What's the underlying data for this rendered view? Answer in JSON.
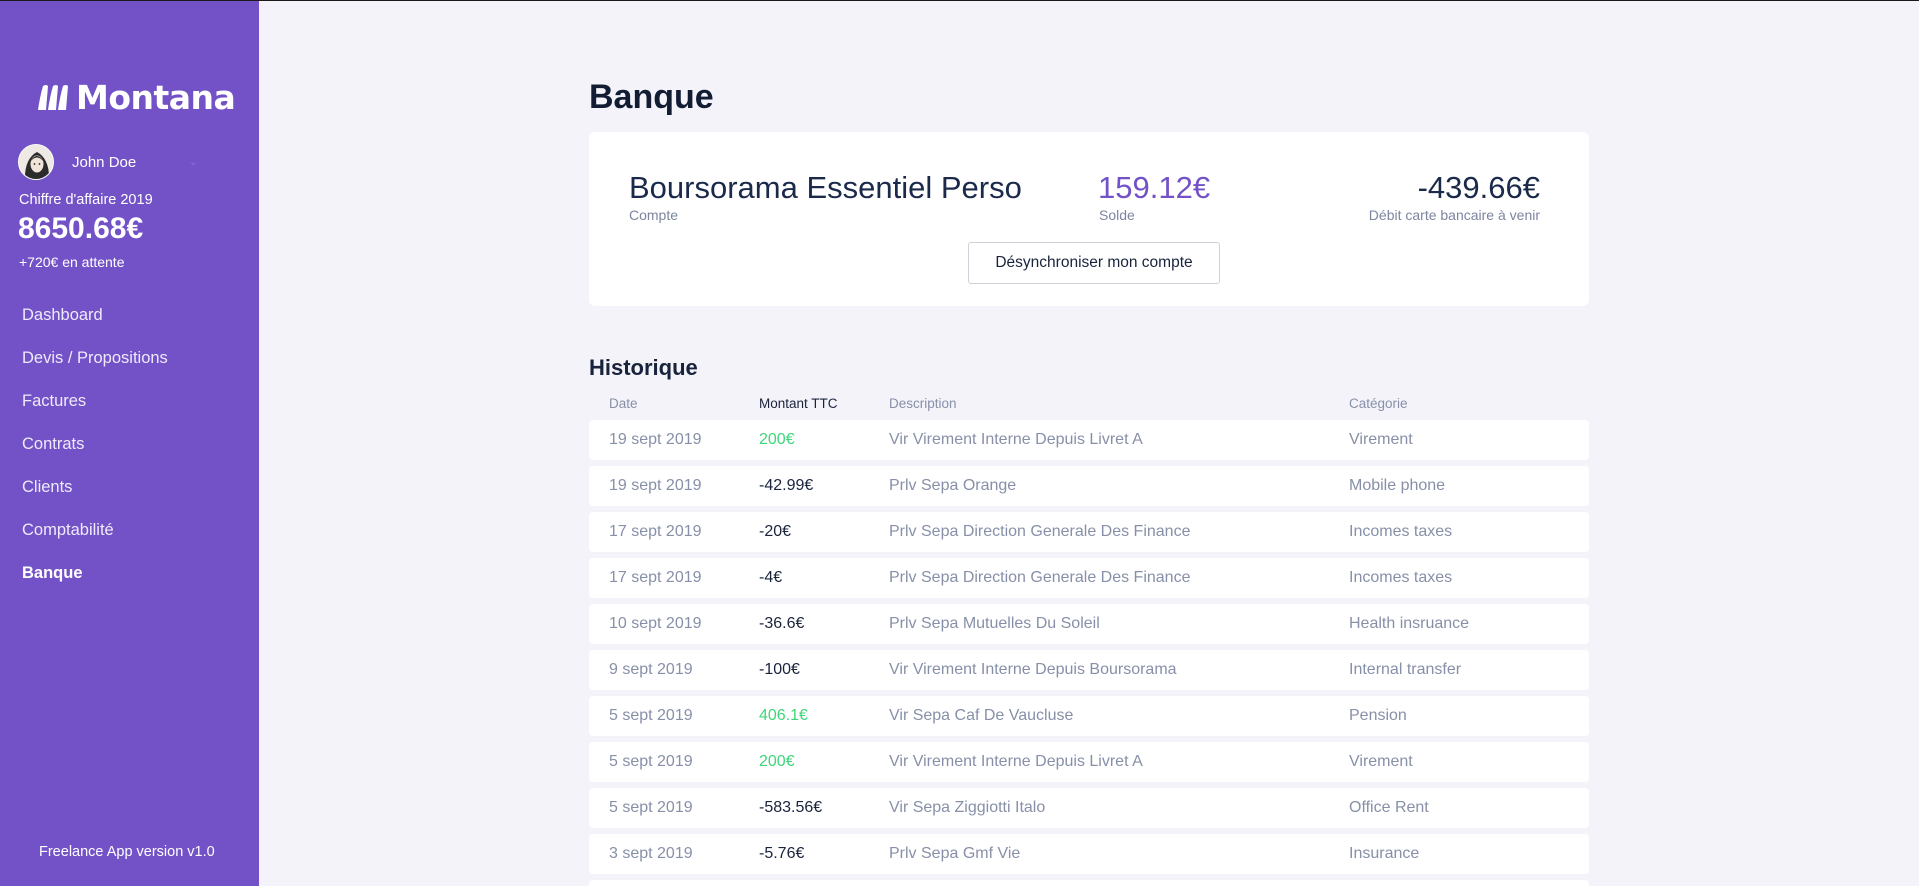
{
  "sidebar": {
    "brand": "Montana",
    "user": {
      "name": "John Doe"
    },
    "revenue": {
      "label": "Chiffre d'affaire 2019",
      "value": "8650.68€",
      "pending": "+720€ en attente"
    },
    "nav": [
      {
        "label": "Dashboard",
        "active": false
      },
      {
        "label": "Devis / Propositions",
        "active": false
      },
      {
        "label": "Factures",
        "active": false
      },
      {
        "label": "Contrats",
        "active": false
      },
      {
        "label": "Clients",
        "active": false
      },
      {
        "label": "Comptabilité",
        "active": false
      },
      {
        "label": "Banque",
        "active": true
      }
    ],
    "version": "Freelance App version v1.0"
  },
  "page": {
    "title": "Banque"
  },
  "account": {
    "name": "Boursorama Essentiel Perso",
    "name_label": "Compte",
    "balance": "159.12€",
    "balance_label": "Solde",
    "debit": "-439.66€",
    "debit_label": "Débit carte bancaire à venir",
    "desync_label": "Désynchroniser mon compte"
  },
  "history": {
    "title": "Historique",
    "columns": {
      "date": "Date",
      "amount": "Montant TTC",
      "description": "Description",
      "category": "Catégorie"
    },
    "rows": [
      {
        "date": "19 sept 2019",
        "amount": "200€",
        "positive": true,
        "description": "Vir Virement Interne Depuis Livret A",
        "category": "Virement"
      },
      {
        "date": "19 sept 2019",
        "amount": "-42.99€",
        "positive": false,
        "description": "Prlv Sepa Orange",
        "category": "Mobile phone"
      },
      {
        "date": "17 sept 2019",
        "amount": "-20€",
        "positive": false,
        "description": "Prlv Sepa Direction Generale Des Finance",
        "category": "Incomes taxes"
      },
      {
        "date": "17 sept 2019",
        "amount": "-4€",
        "positive": false,
        "description": "Prlv Sepa Direction Generale Des Finance",
        "category": "Incomes taxes"
      },
      {
        "date": "10 sept 2019",
        "amount": "-36.6€",
        "positive": false,
        "description": "Prlv Sepa Mutuelles Du Soleil",
        "category": "Health insruance"
      },
      {
        "date": "9 sept 2019",
        "amount": "-100€",
        "positive": false,
        "description": "Vir Virement Interne Depuis Boursorama",
        "category": "Internal transfer"
      },
      {
        "date": "5 sept 2019",
        "amount": "406.1€",
        "positive": true,
        "description": "Vir Sepa Caf De Vaucluse",
        "category": "Pension"
      },
      {
        "date": "5 sept 2019",
        "amount": "200€",
        "positive": true,
        "description": "Vir Virement Interne Depuis Livret A",
        "category": "Virement"
      },
      {
        "date": "5 sept 2019",
        "amount": "-583.56€",
        "positive": false,
        "description": "Vir Sepa Ziggiotti Italo",
        "category": "Office Rent"
      },
      {
        "date": "3 sept 2019",
        "amount": "-5.76€",
        "positive": false,
        "description": "Prlv Sepa Gmf Vie",
        "category": "Insurance"
      }
    ]
  },
  "colors": {
    "sidebar_bg": "#7352c7",
    "accent": "#7352c7",
    "positive_amount": "#3ed67a",
    "page_bg": "#f4f3fa"
  },
  "icons": {
    "logo": "montana-logo-icon",
    "avatar": "avatar",
    "chevron": "chevron-down-icon"
  }
}
